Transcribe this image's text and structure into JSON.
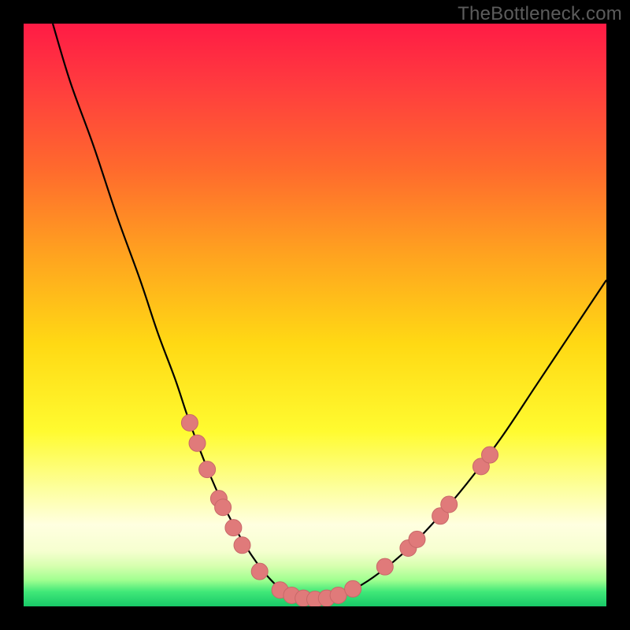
{
  "watermark": "TheBottleneck.com",
  "colors": {
    "frame": "#000000",
    "curve": "#000000",
    "marker_fill": "#e07a7a",
    "marker_stroke": "#c86868",
    "gradient_stops": [
      {
        "offset": 0.0,
        "color": "#ff1b45"
      },
      {
        "offset": 0.1,
        "color": "#ff3a3f"
      },
      {
        "offset": 0.25,
        "color": "#ff6a2d"
      },
      {
        "offset": 0.4,
        "color": "#ffa41f"
      },
      {
        "offset": 0.55,
        "color": "#ffd914"
      },
      {
        "offset": 0.7,
        "color": "#fffb30"
      },
      {
        "offset": 0.8,
        "color": "#fdffa0"
      },
      {
        "offset": 0.86,
        "color": "#ffffe0"
      },
      {
        "offset": 0.905,
        "color": "#f6ffd0"
      },
      {
        "offset": 0.93,
        "color": "#d8ffb0"
      },
      {
        "offset": 0.955,
        "color": "#a0ff90"
      },
      {
        "offset": 0.975,
        "color": "#40e878"
      },
      {
        "offset": 1.0,
        "color": "#18c968"
      }
    ]
  },
  "chart_data": {
    "type": "line",
    "title": "",
    "xlabel": "",
    "ylabel": "",
    "xlim": [
      0,
      100
    ],
    "ylim": [
      0,
      100
    ],
    "note": "Axis values are estimated from pixel positions; no numeric tick labels are shown in the source image.",
    "series": [
      {
        "name": "bottleneck-curve",
        "x": [
          5,
          8,
          12,
          16,
          20,
          23,
          26,
          28,
          30,
          32,
          34,
          36,
          38,
          40,
          42,
          44,
          47,
          50,
          53,
          56,
          60,
          65,
          70,
          76,
          82,
          88,
          94,
          100
        ],
        "y": [
          100,
          90,
          79,
          67,
          56,
          47,
          39,
          33,
          27.5,
          22.5,
          18,
          14,
          10.5,
          7.5,
          5,
          3.2,
          1.8,
          1.2,
          1.5,
          2.6,
          5,
          9,
          14,
          21,
          29,
          38,
          47,
          56
        ]
      }
    ],
    "markers": {
      "name": "highlight-points",
      "note": "Salmon circular markers on lower portion of both arms and trough",
      "points": [
        {
          "x": 28.5,
          "y": 31.5
        },
        {
          "x": 29.8,
          "y": 28.0
        },
        {
          "x": 31.5,
          "y": 23.5
        },
        {
          "x": 33.5,
          "y": 18.5
        },
        {
          "x": 34.2,
          "y": 17.0
        },
        {
          "x": 36.0,
          "y": 13.5
        },
        {
          "x": 37.5,
          "y": 10.5
        },
        {
          "x": 40.5,
          "y": 6.0
        },
        {
          "x": 44.0,
          "y": 2.8
        },
        {
          "x": 46.0,
          "y": 1.9
        },
        {
          "x": 48.0,
          "y": 1.4
        },
        {
          "x": 50.0,
          "y": 1.2
        },
        {
          "x": 52.0,
          "y": 1.4
        },
        {
          "x": 54.0,
          "y": 1.9
        },
        {
          "x": 56.5,
          "y": 3.0
        },
        {
          "x": 62.0,
          "y": 6.8
        },
        {
          "x": 66.0,
          "y": 10.0
        },
        {
          "x": 67.5,
          "y": 11.5
        },
        {
          "x": 71.5,
          "y": 15.5
        },
        {
          "x": 73.0,
          "y": 17.5
        },
        {
          "x": 78.5,
          "y": 24.0
        },
        {
          "x": 80.0,
          "y": 26.0
        }
      ]
    }
  }
}
